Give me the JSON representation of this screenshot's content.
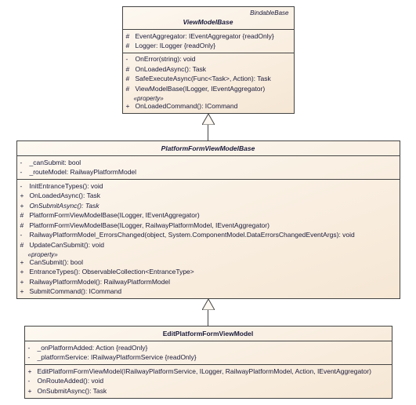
{
  "classes": {
    "vmb": {
      "stereotype_top": "BindableBase",
      "name": "ViewModelBase",
      "fields": [
        {
          "vis": "#",
          "sig": "EventAggregator: IEventAggregator {readOnly}"
        },
        {
          "vis": "#",
          "sig": "Logger: ILogger {readOnly}"
        }
      ],
      "methods": [
        {
          "vis": "-",
          "sig": "OnError(string): void"
        },
        {
          "vis": "#",
          "sig": "OnLoadedAsync(): Task"
        },
        {
          "vis": "#",
          "sig": "SafeExecuteAsync(Func<Task>, Action): Task"
        },
        {
          "vis": "#",
          "sig": "ViewModelBase(ILogger, IEventAggregator)"
        }
      ],
      "prop_label": "«property»",
      "props": [
        {
          "vis": "+",
          "sig": "OnLoadedCommand(): ICommand"
        }
      ]
    },
    "pfvmb": {
      "name": "PlatformFormViewModelBase",
      "fields": [
        {
          "vis": "-",
          "sig": "_canSubmit: bool"
        },
        {
          "vis": "-",
          "sig": "_routeModel: RailwayPlatformModel"
        }
      ],
      "methods": [
        {
          "vis": "-",
          "sig": "InitEntranceTypes(): void"
        },
        {
          "vis": "+",
          "sig": "OnLoadedAsync(): Task"
        },
        {
          "vis": "+",
          "sig": "OnSubmitAsync(): Task",
          "italic": true
        },
        {
          "vis": "#",
          "sig": "PlatformFormViewModelBase(ILogger, IEventAggregator)"
        },
        {
          "vis": "#",
          "sig": "PlatformFormViewModelBase(ILogger, RailwayPlatformModel, IEventAggregator)"
        },
        {
          "vis": "-",
          "sig": "RailwayPlatformModel_ErrorsChanged(object, System.ComponentModel.DataErrorsChangedEventArgs): void"
        },
        {
          "vis": "#",
          "sig": "UpdateCanSubmit(): void"
        }
      ],
      "prop_label": "«property»",
      "props": [
        {
          "vis": "+",
          "sig": "CanSubmit(): bool"
        },
        {
          "vis": "+",
          "sig": "EntranceTypes(): ObservableCollection<EntranceType>"
        },
        {
          "vis": "+",
          "sig": "RailwayPlatformModel(): RailwayPlatformModel"
        },
        {
          "vis": "+",
          "sig": "SubmitCommand(): ICommand"
        }
      ]
    },
    "epfvm": {
      "name": "EditPlatformFormViewModel",
      "fields": [
        {
          "vis": "-",
          "sig": "_onPlatformAdded: Action {readOnly}"
        },
        {
          "vis": "-",
          "sig": "_platformService: IRailwayPlatformService {readOnly}"
        }
      ],
      "methods": [
        {
          "vis": "+",
          "sig": "EditPlatformFormViewModel(IRailwayPlatformService, ILogger, RailwayPlatformModel, Action, IEventAggregator)"
        },
        {
          "vis": "-",
          "sig": "OnRouteAdded(): void"
        },
        {
          "vis": "+",
          "sig": "OnSubmitAsync(): Task"
        }
      ]
    }
  }
}
